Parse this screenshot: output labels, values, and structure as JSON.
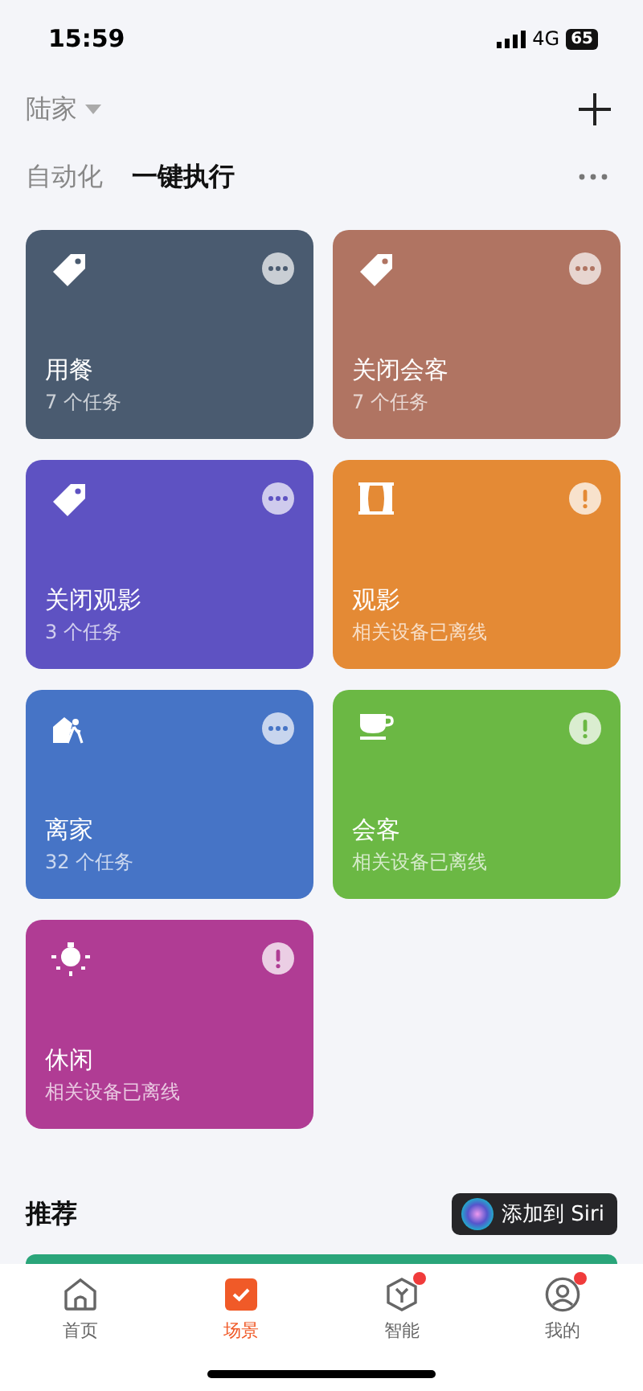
{
  "status_bar": {
    "time": "15:59",
    "network": "4G",
    "battery": "65"
  },
  "header": {
    "home": "陆家"
  },
  "tabs": [
    {
      "label": "自动化",
      "selected": false
    },
    {
      "label": "一键执行",
      "selected": true
    }
  ],
  "scenes": [
    {
      "title": "用餐",
      "subtitle": "7 个任务",
      "kind": "tag",
      "offline": false,
      "color": "#4a5b70"
    },
    {
      "title": "关闭会客",
      "subtitle": "7 个任务",
      "kind": "tag",
      "offline": false,
      "color": "#b07462"
    },
    {
      "title": "关闭观影",
      "subtitle": "3 个任务",
      "kind": "tag",
      "offline": false,
      "color": "#5e52c2"
    },
    {
      "title": "观影",
      "subtitle": "相关设备已离线",
      "kind": "curtain",
      "offline": true,
      "color": "#e48a35"
    },
    {
      "title": "离家",
      "subtitle": "32 个任务",
      "kind": "leave",
      "offline": false,
      "color": "#4674c6"
    },
    {
      "title": "会客",
      "subtitle": "相关设备已离线",
      "kind": "cup",
      "offline": true,
      "color": "#6bb844"
    },
    {
      "title": "休闲",
      "subtitle": "相关设备已离线",
      "kind": "bulb",
      "offline": true,
      "color": "#b03c94"
    }
  ],
  "recommend": {
    "title": "推荐",
    "siri_button": "添加到 Siri"
  },
  "nav": [
    {
      "label": "首页",
      "kind": "home",
      "selected": false,
      "dot": false
    },
    {
      "label": "场景",
      "kind": "scene",
      "selected": true,
      "dot": false
    },
    {
      "label": "智能",
      "kind": "hex",
      "selected": false,
      "dot": true
    },
    {
      "label": "我的",
      "kind": "user",
      "selected": false,
      "dot": true
    }
  ]
}
